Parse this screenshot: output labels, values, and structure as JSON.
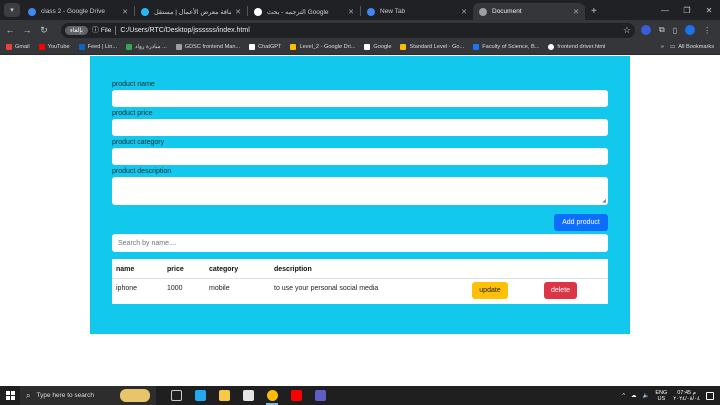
{
  "browser": {
    "tabs": [
      {
        "title": "class 2 - Google Drive",
        "color": "#4285f4",
        "active": false
      },
      {
        "title": "إضافة معرض الأعمال | مستقل",
        "color": "#29b6f6",
        "active": false
      },
      {
        "title": "الترجمه - بحث Google",
        "color": "#ffffff",
        "active": false
      },
      {
        "title": "New Tab",
        "color": "#4285f4",
        "active": false
      },
      {
        "title": "Document",
        "color": "#9aa0a6",
        "active": true
      }
    ],
    "omnibox": {
      "chip": "بإلغاء",
      "scheme_label": "File",
      "url": "C:/Users/RTC/Desktop/jssssss/index.html"
    },
    "bookmarks": [
      {
        "label": "Gmail",
        "color": "#ea4335"
      },
      {
        "label": "YouTube",
        "color": "#ff0000"
      },
      {
        "label": "Feed | Lin...",
        "color": "#0a66c2"
      },
      {
        "label": "مبادرة رواد ...",
        "color": "#34a853"
      },
      {
        "label": "GDSC frontend Man...",
        "color": "#9e9e9e"
      },
      {
        "label": "ChatGPT",
        "color": "#ffffff"
      },
      {
        "label": "Level_2 - Google Dri...",
        "color": "#fbbc04"
      },
      {
        "label": "Google",
        "color": "#ffffff"
      },
      {
        "label": "Standard Level - Go...",
        "color": "#fbbc04"
      },
      {
        "label": "Faculty of Science, B...",
        "color": "#1877f2"
      },
      {
        "label": "frontend driver.html",
        "color": "#ffffff"
      }
    ],
    "all_bookmarks": "All Bookmarks"
  },
  "form": {
    "name_label": "product name",
    "price_label": "product price",
    "category_label": "product category",
    "description_label": "product description",
    "name_value": "",
    "price_value": "",
    "category_value": "",
    "description_value": "",
    "add_button": "Add product",
    "search_placeholder": "Search by name....",
    "accent": "#12c8ec"
  },
  "table": {
    "headers": [
      "name",
      "price",
      "category",
      "description"
    ],
    "rows": [
      {
        "name": "iphone",
        "price": "1000",
        "category": "mobile",
        "description": "to use your personal social media",
        "update": "update",
        "delete": "delete"
      }
    ]
  },
  "taskbar": {
    "search_placeholder": "Type here to search",
    "apps": [
      {
        "name": "task-view",
        "color": "#cccccc"
      },
      {
        "name": "vscode",
        "color": "#23a9f2"
      },
      {
        "name": "file-explorer",
        "color": "#f9c846"
      },
      {
        "name": "store",
        "color": "#e6e6e6"
      },
      {
        "name": "chrome",
        "color": "#fbbc04"
      },
      {
        "name": "youtube",
        "color": "#ff0000"
      },
      {
        "name": "teams",
        "color": "#5b5fc7"
      }
    ],
    "lang_top": "ENG",
    "lang_bottom": "US",
    "time": "07:45 م",
    "date": "٢٠٢٤/٠٨/٠٤"
  }
}
